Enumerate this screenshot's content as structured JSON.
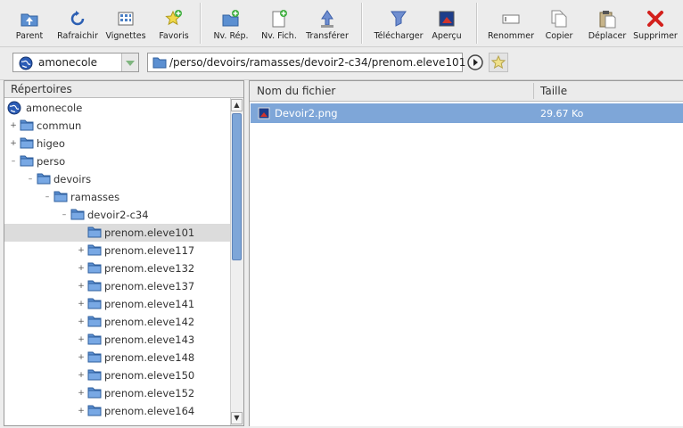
{
  "toolbar": {
    "buttons": [
      {
        "id": "parent",
        "label": "Parent"
      },
      {
        "id": "refresh",
        "label": "Rafraichir"
      },
      {
        "id": "thumbnails",
        "label": "Vignettes"
      },
      {
        "id": "favorites",
        "label": "Favoris"
      },
      {
        "id": "newdir",
        "label": "Nv. Rép."
      },
      {
        "id": "newfile",
        "label": "Nv. Fich."
      },
      {
        "id": "transfer",
        "label": "Transférer"
      },
      {
        "id": "download",
        "label": "Télécharger"
      },
      {
        "id": "preview",
        "label": "Aperçu"
      },
      {
        "id": "rename",
        "label": "Renommer"
      },
      {
        "id": "copy",
        "label": "Copier"
      },
      {
        "id": "move",
        "label": "Déplacer"
      },
      {
        "id": "delete",
        "label": "Supprimer"
      }
    ]
  },
  "address": {
    "server": "amonecole",
    "path": "/perso/devoirs/ramasses/devoir2-c34/prenom.eleve101"
  },
  "tree": {
    "header": "Répertoires",
    "root": "amonecole",
    "nodes": [
      {
        "label": "commun",
        "level": 1,
        "exp": "+"
      },
      {
        "label": "higeo",
        "level": 1,
        "exp": "+"
      },
      {
        "label": "perso",
        "level": 1,
        "exp": "–"
      },
      {
        "label": "devoirs",
        "level": 2,
        "exp": "–"
      },
      {
        "label": "ramasses",
        "level": 3,
        "exp": "–"
      },
      {
        "label": "devoir2-c34",
        "level": 4,
        "exp": "–"
      },
      {
        "label": "prenom.eleve101",
        "level": 5,
        "exp": "",
        "selected": true
      },
      {
        "label": "prenom.eleve117",
        "level": 5,
        "exp": "+"
      },
      {
        "label": "prenom.eleve132",
        "level": 5,
        "exp": "+"
      },
      {
        "label": "prenom.eleve137",
        "level": 5,
        "exp": "+"
      },
      {
        "label": "prenom.eleve141",
        "level": 5,
        "exp": "+"
      },
      {
        "label": "prenom.eleve142",
        "level": 5,
        "exp": "+"
      },
      {
        "label": "prenom.eleve143",
        "level": 5,
        "exp": "+"
      },
      {
        "label": "prenom.eleve148",
        "level": 5,
        "exp": "+"
      },
      {
        "label": "prenom.eleve150",
        "level": 5,
        "exp": "+"
      },
      {
        "label": "prenom.eleve152",
        "level": 5,
        "exp": "+"
      },
      {
        "label": "prenom.eleve164",
        "level": 5,
        "exp": "+"
      }
    ]
  },
  "files": {
    "col_name": "Nom du fichier",
    "col_size": "Taille",
    "rows": [
      {
        "name": "Devoir2.png",
        "size": "29.67 Ko"
      }
    ]
  }
}
